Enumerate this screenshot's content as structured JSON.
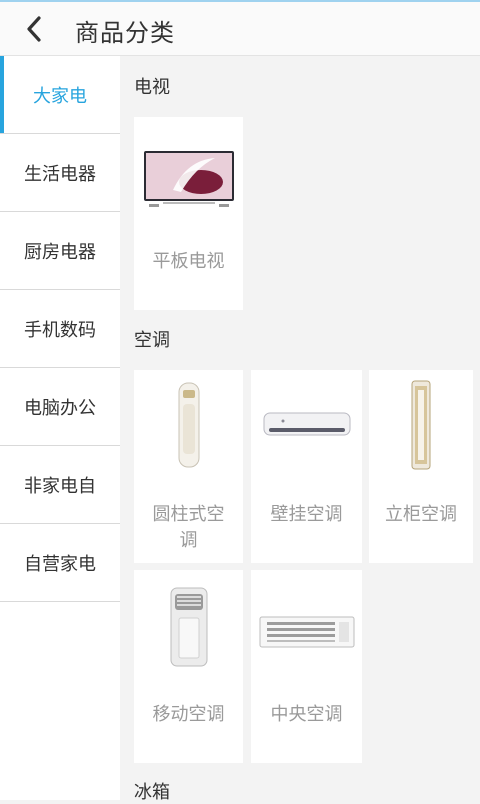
{
  "header": {
    "title": "商品分类"
  },
  "sidebar": {
    "items": [
      {
        "label": "大家电"
      },
      {
        "label": "生活电器"
      },
      {
        "label": "厨房电器"
      },
      {
        "label": "手机数码"
      },
      {
        "label": "电脑办公"
      },
      {
        "label": "非家电自"
      },
      {
        "label": "自营家电"
      }
    ]
  },
  "sections": [
    {
      "title": "电视",
      "items": [
        {
          "label": "平板电视"
        }
      ]
    },
    {
      "title": "空调",
      "items": [
        {
          "label": "圆柱式空调"
        },
        {
          "label": "壁挂空调"
        },
        {
          "label": "立柜空调"
        },
        {
          "label": "移动空调"
        },
        {
          "label": "中央空调"
        }
      ]
    },
    {
      "title": "冰箱",
      "items": []
    }
  ],
  "colors": {
    "accent": "#27a4de",
    "label_gray": "#9a9a9a",
    "bg": "#f3f3f3"
  }
}
